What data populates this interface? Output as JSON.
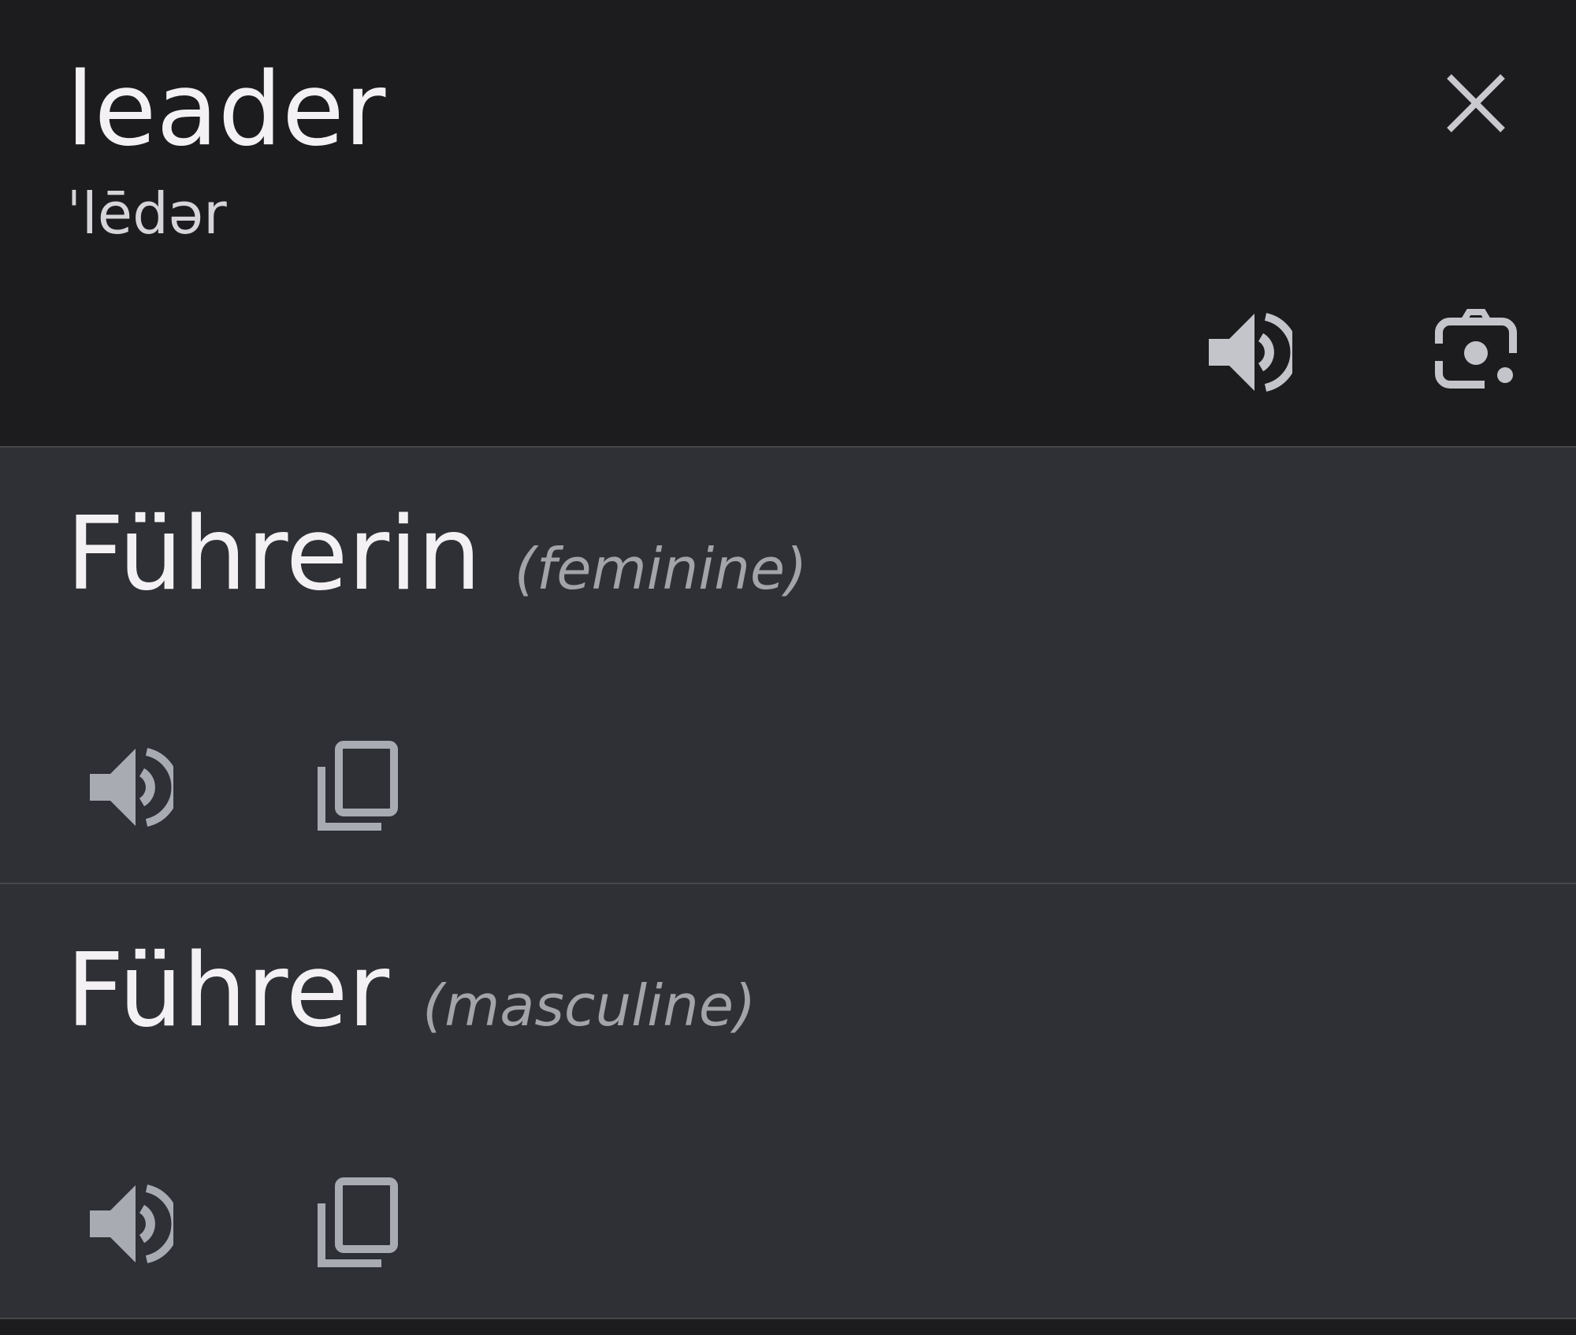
{
  "source": {
    "word": "leader",
    "pronunciation": "ˈlēdər",
    "icons": {
      "close": "close-icon",
      "speak": "speaker-icon",
      "lens": "camera-lens-icon"
    }
  },
  "results": [
    {
      "term": "Führerin",
      "gender": "(feminine)",
      "icons": {
        "speak": "speaker-icon",
        "copy": "copy-icon"
      }
    },
    {
      "term": "Führer",
      "gender": "(masculine)",
      "icons": {
        "speak": "speaker-icon",
        "copy": "copy-icon"
      }
    }
  ],
  "colors": {
    "source_bg": "#1c1c1e",
    "result_bg": "#2f3035",
    "primary_text": "#f3f1f3",
    "secondary_text": "#a3a4aa",
    "icon": "#a9abb2",
    "divider": "#46474b"
  }
}
